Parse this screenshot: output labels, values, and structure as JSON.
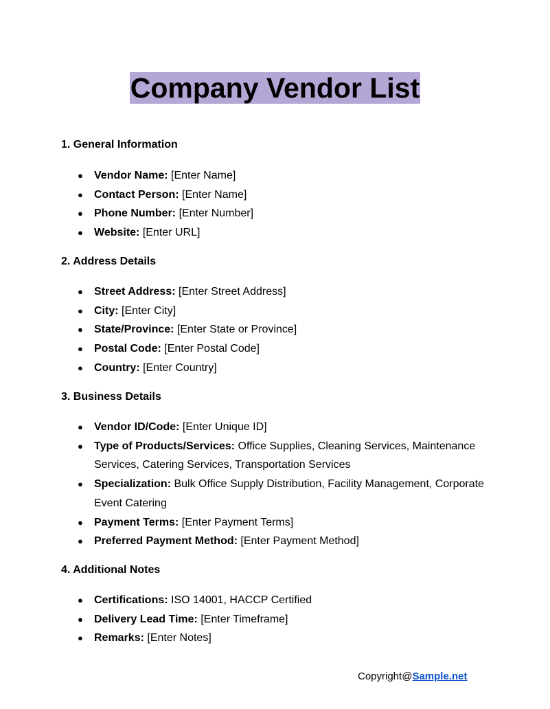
{
  "title": "Company Vendor List",
  "sections": [
    {
      "heading": "1. General Information",
      "items": [
        {
          "label": "Vendor Name:",
          "value": " [Enter Name]"
        },
        {
          "label": "Contact Person:",
          "value": " [Enter Name]"
        },
        {
          "label": "Phone Number:",
          "value": " [Enter Number]"
        },
        {
          "label": "Website:",
          "value": " [Enter URL]"
        }
      ]
    },
    {
      "heading": "2. Address Details",
      "items": [
        {
          "label": "Street Address:",
          "value": " [Enter Street Address]"
        },
        {
          "label": "City:",
          "value": " [Enter City]"
        },
        {
          "label": "State/Province:",
          "value": " [Enter State or Province]"
        },
        {
          "label": "Postal Code:",
          "value": " [Enter Postal Code]"
        },
        {
          "label": "Country:",
          "value": " [Enter Country]"
        }
      ]
    },
    {
      "heading": "3. Business Details",
      "items": [
        {
          "label": "Vendor ID/Code:",
          "value": " [Enter Unique ID]"
        },
        {
          "label": "Type of Products/Services:",
          "value": " Office Supplies, Cleaning Services, Maintenance Services, Catering Services, Transportation Services"
        },
        {
          "label": "Specialization:",
          "value": " Bulk Office Supply Distribution, Facility Management, Corporate Event Catering"
        },
        {
          "label": "Payment Terms:",
          "value": " [Enter Payment Terms]"
        },
        {
          "label": "Preferred Payment Method:",
          "value": " [Enter Payment Method]"
        }
      ]
    },
    {
      "heading": "4. Additional Notes",
      "items": [
        {
          "label": "Certifications:",
          "value": " ISO 14001, HACCP Certified"
        },
        {
          "label": "Delivery Lead Time:",
          "value": " [Enter Timeframe]"
        },
        {
          "label": "Remarks:",
          "value": " [Enter Notes]"
        }
      ]
    }
  ],
  "footer": {
    "prefix": "Copyright@",
    "link_text": "Sample.net"
  },
  "colors": {
    "title_highlight": "#b4a7d6",
    "link": "#1155cc"
  }
}
